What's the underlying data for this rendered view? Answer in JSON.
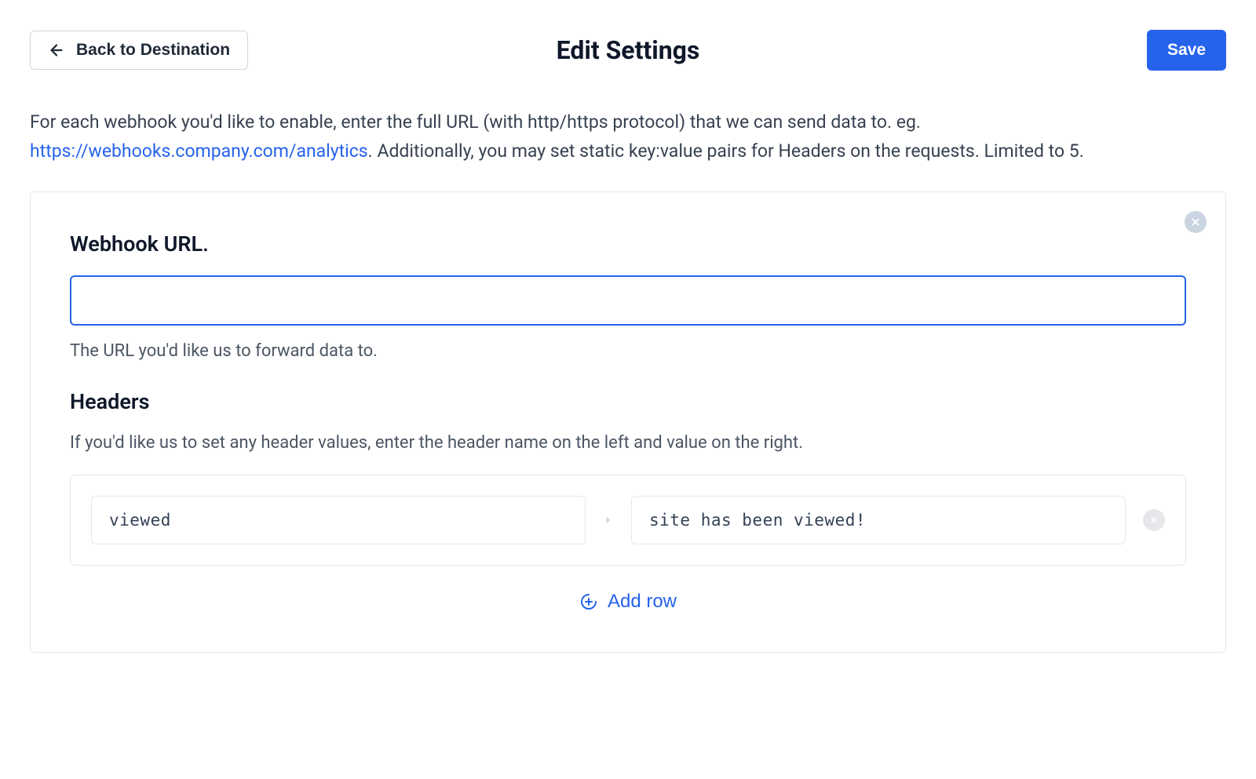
{
  "header": {
    "back_label": "Back to Destination",
    "title": "Edit Settings",
    "save_label": "Save"
  },
  "description": {
    "pre_link": "For each webhook you'd like to enable, enter the full URL (with http/https protocol) that we can send data to. eg. ",
    "link_text": "https://webhooks.company.com/analytics",
    "post_link": ". Additionally, you may set static key:value pairs for Headers on the requests. Limited to 5."
  },
  "card": {
    "url_section_title": "Webhook URL.",
    "url_value": "",
    "url_help": "The URL you'd like us to forward data to.",
    "headers_title": "Headers",
    "headers_desc": "If you'd like us to set any header values, enter the header name on the left and value on the right.",
    "rows": [
      {
        "key": "viewed",
        "value": "site has been viewed!"
      }
    ],
    "add_row_label": "Add row"
  }
}
